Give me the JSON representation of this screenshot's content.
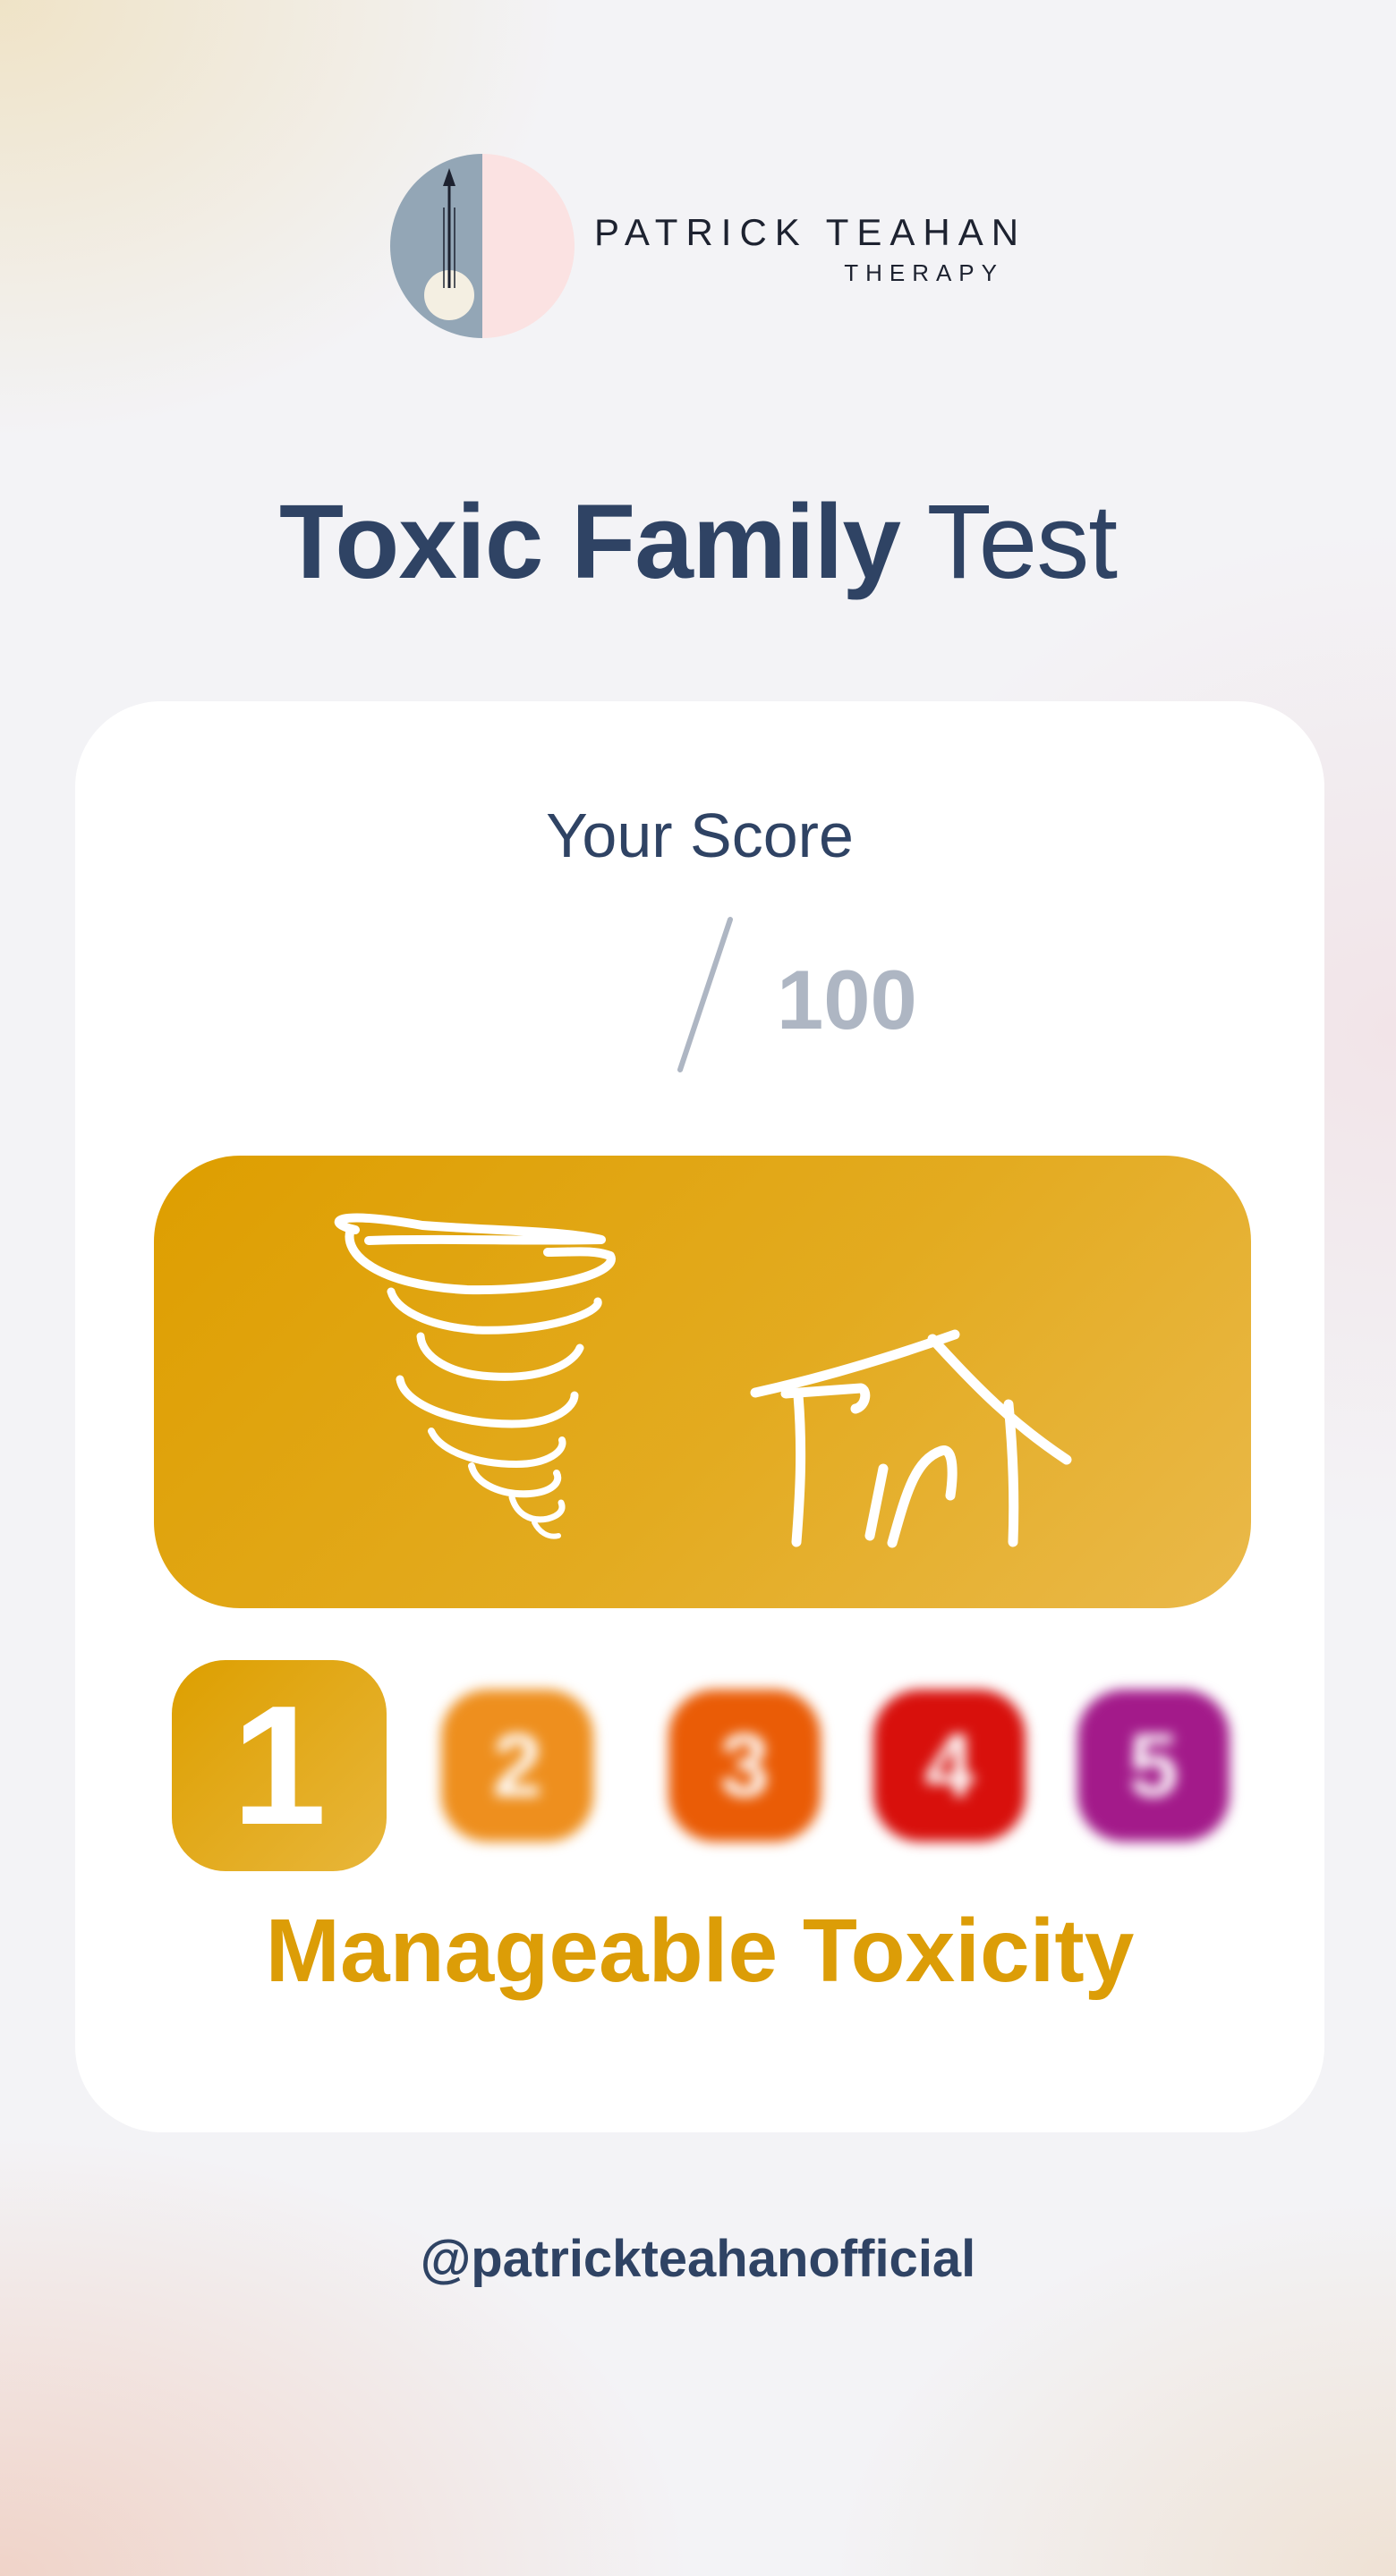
{
  "brand": {
    "name": "PATRICK TEAHAN",
    "subtitle": "THERAPY",
    "logo_colors": {
      "left": "#93a6b6",
      "right": "#fbe2e2",
      "circle": "#f4efe2",
      "arrow": "#1d2230"
    }
  },
  "page_title": {
    "bold": "Toxic Family",
    "regular": "Test"
  },
  "score": {
    "label": "Your Score",
    "value": "",
    "max": "100"
  },
  "banner": {
    "icons": [
      "tornado-icon",
      "house-icon"
    ],
    "color": "#e2a514"
  },
  "levels": [
    {
      "label": "1",
      "color": "#e2a514",
      "active": true
    },
    {
      "label": "2",
      "color": "#ee8f1e",
      "active": false
    },
    {
      "label": "3",
      "color": "#ea5c06",
      "active": false
    },
    {
      "label": "4",
      "color": "#d8100c",
      "active": false
    },
    {
      "label": "5",
      "color": "#a31a8a",
      "active": false
    }
  ],
  "result": {
    "label": "Manageable Toxicity",
    "color": "#dc9d07"
  },
  "footer": {
    "handle": "@patrickteahanofficial"
  },
  "colors": {
    "heading": "#2f4364",
    "muted": "#aeb6c3",
    "card": "#ffffff"
  }
}
